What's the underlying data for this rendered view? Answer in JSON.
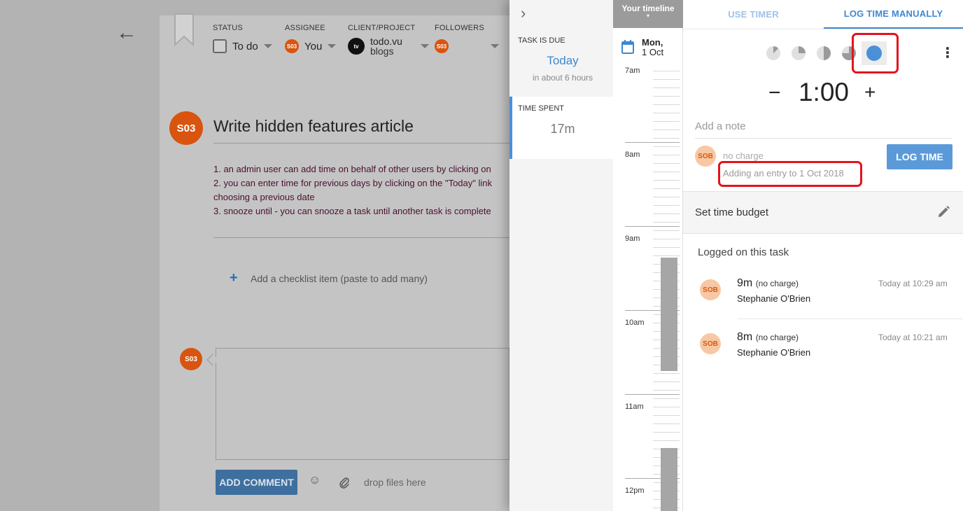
{
  "task": {
    "meta": {
      "status_label": "STATUS",
      "status_value": "To do",
      "assignee_label": "ASSIGNEE",
      "assignee_avatar": "S03",
      "assignee_value": "You",
      "client_label": "CLIENT/PROJECT",
      "client_logo": "tv",
      "client_name": "todo.vu",
      "project_name": "blogs",
      "followers_label": "FOLLOWERS",
      "follower_avatar": "S03"
    },
    "avatar": "S03",
    "title": "Write hidden features article",
    "description": [
      "1. an admin user can add time on behalf of other users by clicking on",
      "2. you can enter time for previous days by clicking on the \"Today\" link",
      "choosing a previous date",
      "3. snooze until - you can snooze a task until another task is complete"
    ],
    "checklist_placeholder": "Add a checklist item (paste to add many)",
    "comment_avatar": "S03",
    "add_comment_label": "ADD COMMENT",
    "drop_files_label": "drop files here"
  },
  "side": {
    "due_label": "TASK IS DUE",
    "due_value": "Today",
    "due_sub": "in about 6 hours",
    "spent_label": "TIME SPENT",
    "spent_value": "17m"
  },
  "timeline": {
    "header": "Your timeline",
    "day": "Mon,",
    "date": "1 Oct",
    "hours": [
      "7am",
      "8am",
      "9am",
      "10am",
      "11am",
      "12pm"
    ]
  },
  "log_panel": {
    "tabs": [
      "USE TIMER",
      "LOG TIME MANUALLY"
    ],
    "active_tab": "LOG TIME MANUALLY",
    "duration_presets": [
      0.125,
      0.25,
      0.5,
      0.75,
      1.0
    ],
    "selected_preset": 1.0,
    "minus": "−",
    "time_value": "1:00",
    "plus": "+",
    "note_placeholder": "Add a note",
    "user_avatar": "SOB",
    "charge_text": "no charge",
    "adding_text": "Adding an entry to 1 Oct 2018",
    "log_button": "LOG TIME",
    "budget_label": "Set time budget",
    "logged_heading": "Logged on this task",
    "entries": [
      {
        "avatar": "SOB",
        "duration": "9m",
        "charge": "(no charge)",
        "user": "Stephanie O'Brien",
        "time": "Today at 10:29 am"
      },
      {
        "avatar": "SOB",
        "duration": "8m",
        "charge": "(no charge)",
        "user": "Stephanie O'Brien",
        "time": "Today at 10:21 am"
      }
    ]
  },
  "colors": {
    "accent": "#3f88d0",
    "avatar_orange": "#d9540f",
    "highlight_red": "#e4121c"
  }
}
